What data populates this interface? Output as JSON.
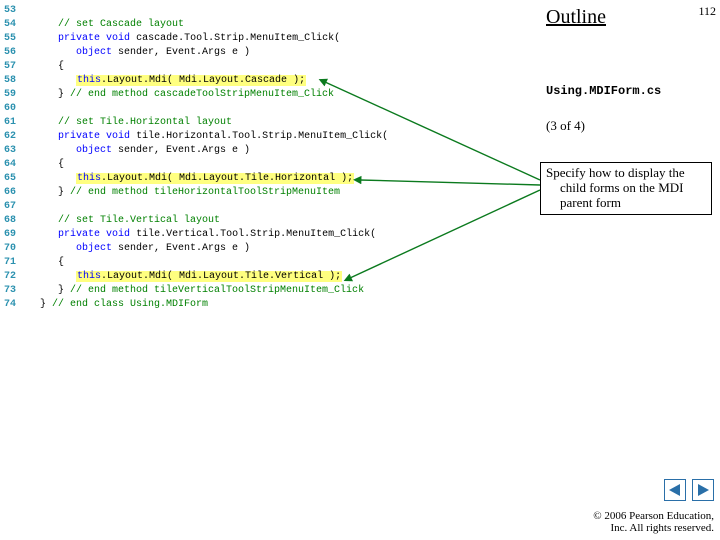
{
  "page_number": "112",
  "outline": {
    "title": "Outline",
    "filename": "Using.MDIForm.cs",
    "pager": "(3 of 4)"
  },
  "callout": {
    "line1": "Specify how to display the",
    "line2": "child forms on the MDI",
    "line3": "parent form"
  },
  "code": {
    "l53": "",
    "l54a": "      // set Cascade layout",
    "l55a": "      ",
    "l55b": "private",
    "l55c": " ",
    "l55d": "void",
    "l55e": " cascade.Tool.Strip.MenuItem_Click(",
    "l56a": "         ",
    "l56b": "object",
    "l56c": " sender, Event.Args e )",
    "l57a": "      {",
    "l58a": "         ",
    "l58b": "this",
    "l58c": ".Layout.Mdi( Mdi.Layout.Cascade );",
    "l59a": "      } ",
    "l59b": "// end method cascadeToolStripMenuItem_Click",
    "l60": "",
    "l61a": "      // set Tile.Horizontal layout",
    "l62a": "      ",
    "l62b": "private",
    "l62c": " ",
    "l62d": "void",
    "l62e": " tile.Horizontal.Tool.Strip.MenuItem_Click(",
    "l63a": "         ",
    "l63b": "object",
    "l63c": " sender, Event.Args e )",
    "l64a": "      {",
    "l65a": "         ",
    "l65b": "this",
    "l65c": ".Layout.Mdi( Mdi.Layout.Tile.Horizontal );",
    "l66a": "      } ",
    "l66b": "// end method tileHorizontalToolStripMenuItem",
    "l67": "",
    "l68a": "      // set Tile.Vertical layout",
    "l69a": "      ",
    "l69b": "private",
    "l69c": " ",
    "l69d": "void",
    "l69e": " tile.Vertical.Tool.Strip.MenuItem_Click(",
    "l70a": "         ",
    "l70b": "object",
    "l70c": " sender, Event.Args e )",
    "l71a": "      {",
    "l72a": "         ",
    "l72b": "this",
    "l72c": ".Layout.Mdi( Mdi.Layout.Tile.Vertical );",
    "l73a": "      } ",
    "l73b": "// end method tileVerticalToolStripMenuItem_Click",
    "l74a": "   } ",
    "l74b": "// end class Using.MDIForm"
  },
  "footer": {
    "line1": "© 2006 Pearson Education,",
    "line2": "Inc.  All rights reserved."
  },
  "colors": {
    "highlight": "#ffff80",
    "comment": "#008000",
    "keyword": "#0000ff",
    "line_num": "#2b91af",
    "arrow": "#0b7a1e",
    "nav_border": "#2a6fa8"
  }
}
